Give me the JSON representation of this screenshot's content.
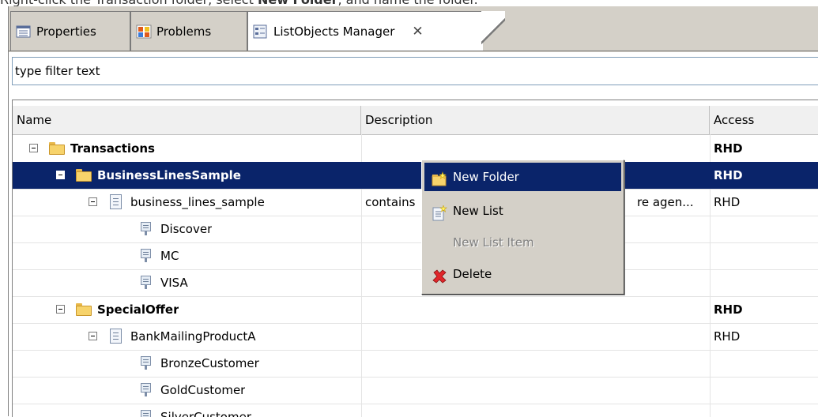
{
  "caption": {
    "prefix": "Right-click the Transaction folder, select ",
    "emphasis": "New Folder",
    "suffix": ", and name the folder."
  },
  "tabs": [
    {
      "label": "Properties",
      "icon": "properties-icon"
    },
    {
      "label": "Problems",
      "icon": "problems-icon"
    },
    {
      "label": "ListObjects Manager",
      "icon": "list-manager-icon",
      "close": "✕"
    }
  ],
  "filter": {
    "value": "type filter text"
  },
  "columns": {
    "name": "Name",
    "description": "Description",
    "access": "Access"
  },
  "rows": [
    {
      "name": "Transactions",
      "description": "",
      "access": "RHD"
    },
    {
      "name": "BusinessLinesSample",
      "description": "",
      "access": "RHD"
    },
    {
      "name": "business_lines_sample",
      "description": "contains",
      "description_tail": "re agen...",
      "access": "RHD"
    },
    {
      "name": "Discover",
      "description": "",
      "access": ""
    },
    {
      "name": "MC",
      "description": "",
      "access": ""
    },
    {
      "name": "VISA",
      "description": "",
      "access": ""
    },
    {
      "name": "SpecialOffer",
      "description": "",
      "access": "RHD"
    },
    {
      "name": "BankMailingProductA",
      "description": "",
      "access": "RHD"
    },
    {
      "name": "BronzeCustomer",
      "description": "",
      "access": ""
    },
    {
      "name": "GoldCustomer",
      "description": "",
      "access": ""
    },
    {
      "name": "SilverCustomer",
      "description": "",
      "access": ""
    }
  ],
  "context_menu": {
    "items": [
      {
        "label": "New Folder",
        "icon": "new-folder-icon",
        "state": "highlighted"
      },
      {
        "label": "New List",
        "icon": "new-list-icon",
        "state": "enabled"
      },
      {
        "label": "New List Item",
        "icon": "",
        "state": "disabled"
      },
      {
        "label": "Delete",
        "icon": "delete-icon",
        "state": "enabled"
      }
    ]
  },
  "colors": {
    "selection": "#0a246a",
    "chrome": "#d4d0c8",
    "delete": "#e0262b",
    "folder": "#f7d36b"
  }
}
